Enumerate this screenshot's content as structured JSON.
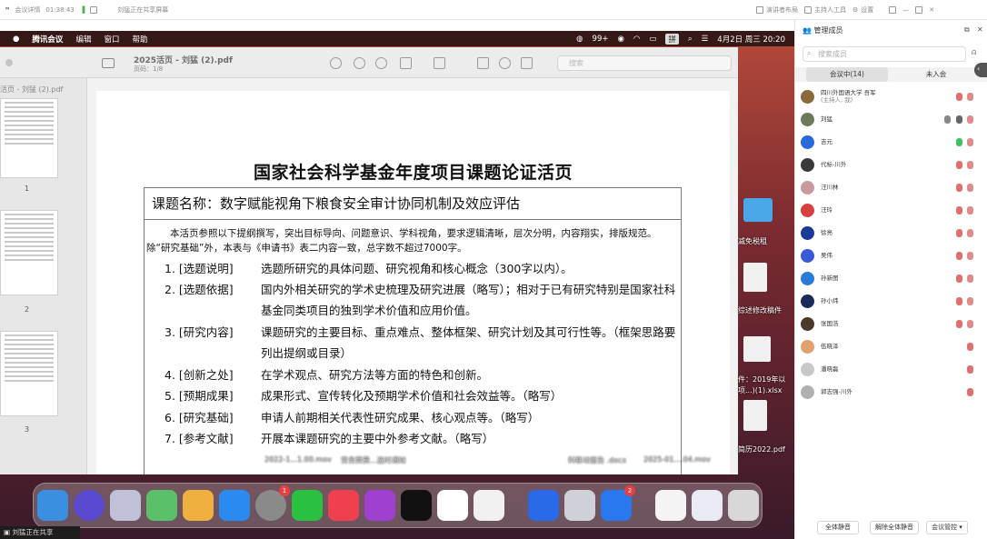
{
  "topbar": {
    "app": "会议详情",
    "timer": "01:38:43",
    "sharing": "刘猛正在共享屏幕",
    "actions": [
      "演讲者布局",
      "主持人工具",
      "设置"
    ]
  },
  "menubar": {
    "app": "腾讯会议",
    "items": [
      "编辑",
      "窗口",
      "帮助"
    ],
    "battery": "99+",
    "ime": "拼",
    "datetime": "4月2日 周三  20:20"
  },
  "pdf": {
    "title": "2025活页 - 刘猛 (2).pdf",
    "pages": "页码：1/8",
    "search_placeholder": "搜索",
    "sidebar_title": "活页 - 刘猛 (2).pdf",
    "page_numbers": [
      "1",
      "2",
      "3"
    ]
  },
  "doc": {
    "title": "国家社会科学基金年度项目课题论证活页",
    "project": "课题名称：数字赋能视角下粮食安全审计协同机制及效应评估",
    "intro": "本活页参照以下提纲撰写，突出目标导向、问题意识、学科视角，要求逻辑清晰，层次分明，内容翔实，排版规范。除“研究基础”外，本表与《申请书》表二内容一致，总字数不超过7000字。",
    "items": [
      {
        "tag": "1. [选题说明]",
        "text": "选题所研究的具体问题、研究视角和核心概念（300字以内）。"
      },
      {
        "tag": "2. [选题依据]",
        "text": "国内外相关研究的学术史梳理及研究进展（略写）；相对于已有研究特别是国家社科基金同类项目的独到学术价值和应用价值。"
      },
      {
        "tag": "3. [研究内容]",
        "text": "课题研究的主要目标、重点难点、整体框架、研究计划及其可行性等。（框架思路要列出提纲或目录）"
      },
      {
        "tag": "4. [创新之处]",
        "text": "在学术观点、研究方法等方面的特色和创新。"
      },
      {
        "tag": "5. [预期成果]",
        "text": "成果形式、宣传转化及预期学术价值和社会效益等。（略写）"
      },
      {
        "tag": "6. [研究基础]",
        "text": "申请人前期相关代表性研究成果、核心观点等。（略写）"
      },
      {
        "tag": "7. [参考文献]",
        "text": "开展本课题研究的主要中外参考文献。（略写）"
      }
    ]
  },
  "desktop": {
    "files": [
      "减免税租",
      "综述修改稿件",
      "件：2019年以",
      "项...)(1).xlsx",
      "简历2022.pdf",
      "2022-1...1.00.mov",
      "劳务照费...选时通知",
      "科联动报告 .docx",
      "2025-01....04.mov"
    ]
  },
  "dock": {
    "badges": [
      "1",
      "2"
    ]
  },
  "share_banner": "刘猛正在共享",
  "panel": {
    "title": "管理成员",
    "search_placeholder": "搜索成员",
    "tab_in": "会议中(14)",
    "tab_out": "未入会",
    "members": [
      {
        "name": "四川外国语大学 吾军",
        "sub": "(主持人, 我)",
        "color": "#8a6a3a"
      },
      {
        "name": "刘猛",
        "sub": "",
        "color": "#6a7a5a"
      },
      {
        "name": "吉元",
        "sub": "",
        "color": "#2a6ad8"
      },
      {
        "name": "代标-川外",
        "sub": "",
        "color": "#3a3a3a"
      },
      {
        "name": "汪川林",
        "sub": "",
        "color": "#c89aa0"
      },
      {
        "name": "汪玲",
        "sub": "",
        "color": "#d84040"
      },
      {
        "name": "吴伟",
        "sub": "",
        "color": "#3a5ad8"
      },
      {
        "name": "徐亮",
        "sub": "",
        "color": "#1a3a9a"
      },
      {
        "name": "孙新图",
        "sub": "",
        "color": "#2a7ad8"
      },
      {
        "name": "孙小炜",
        "sub": "",
        "color": "#1a2a5a"
      },
      {
        "name": "张国浩",
        "sub": "",
        "color": "#4a3a2a"
      },
      {
        "name": "伍晓泽",
        "sub": "",
        "color": "#e0a070"
      },
      {
        "name": "潘晓磊",
        "sub": "",
        "color": "#c8c8c8"
      },
      {
        "name": "郭志强-川外",
        "sub": "",
        "color": "#b0b0b0"
      }
    ],
    "buttons": [
      "全体静音",
      "解除全体静音",
      "会议管控 ▾"
    ]
  }
}
